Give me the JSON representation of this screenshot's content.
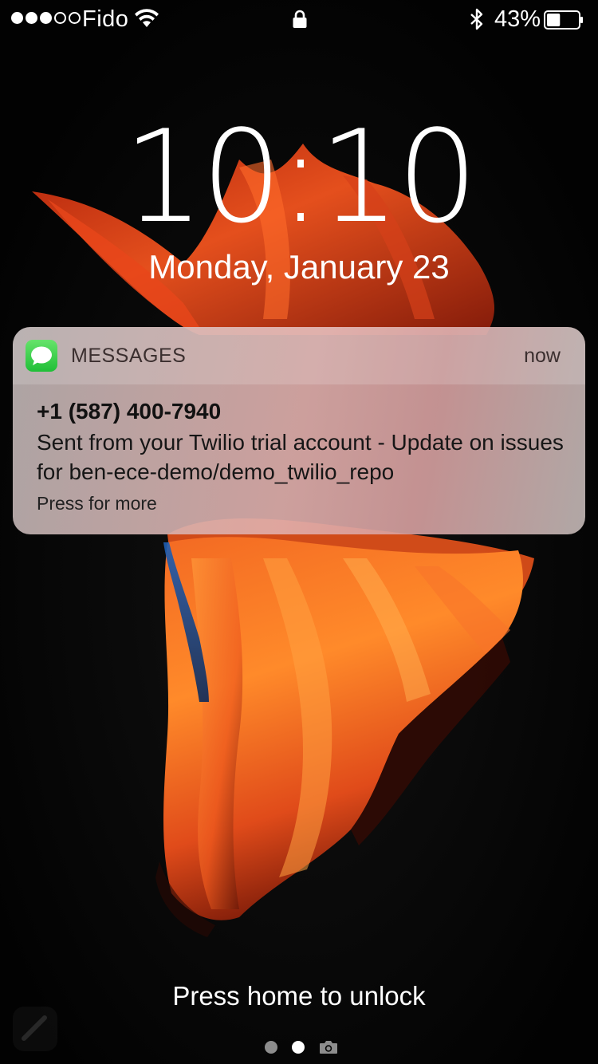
{
  "status_bar": {
    "signal_bars_filled": 3,
    "signal_bars_total": 5,
    "carrier": "Fido",
    "wifi_icon": "wifi-icon",
    "lock_icon": "lock-icon",
    "bluetooth_icon": "bluetooth-icon",
    "battery_percent": "43%",
    "battery_level": 0.43
  },
  "lock_screen": {
    "time": "10:10",
    "date": "Monday, January 23",
    "unlock_hint": "Press home to unlock",
    "page_indicator": {
      "count": 2,
      "active_index": 1
    },
    "camera_icon": "camera-icon",
    "flashlight_icon": "flashlight-icon"
  },
  "notification": {
    "app_name": "MESSAGES",
    "app_icon": "messages-bubble-icon",
    "time": "now",
    "sender": "+1 (587) 400-7940",
    "body": "Sent from your Twilio trial account - Update on issues for ben-ece-demo/demo_twilio_repo",
    "hint": "Press for more"
  },
  "colors": {
    "fish_orange": "#f0531e",
    "fish_red": "#c9290f",
    "messages_green": "#34c84a",
    "background": "#050505"
  }
}
